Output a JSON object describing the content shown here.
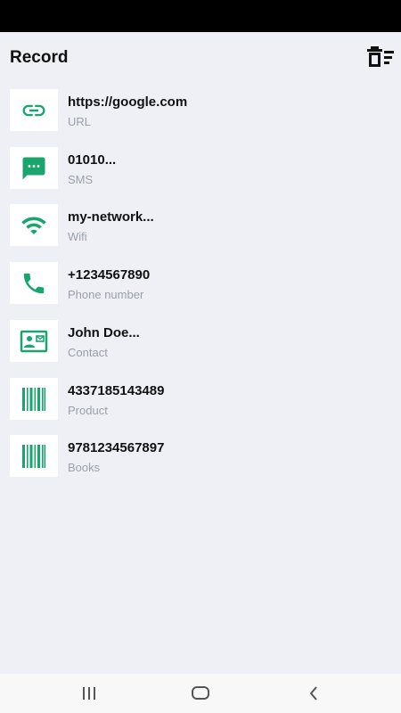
{
  "app_bar": {
    "title": "Record",
    "clear_icon": "delete-sweep-icon"
  },
  "colors": {
    "accent": "#1aa56f",
    "background": "#eef0f5",
    "tile": "#ffffff",
    "subtitle": "#9aa0ab"
  },
  "records": [
    {
      "title": "https://google.com",
      "type": "URL",
      "icon": "link-icon"
    },
    {
      "title": "01010...",
      "type": "SMS",
      "icon": "message-icon"
    },
    {
      "title": "my-network...",
      "type": "Wifi",
      "icon": "wifi-icon"
    },
    {
      "title": "+1234567890",
      "type": "Phone number",
      "icon": "phone-icon"
    },
    {
      "title": "John Doe...",
      "type": "Contact",
      "icon": "contact-card-icon"
    },
    {
      "title": "4337185143489",
      "type": "Product",
      "icon": "barcode-icon"
    },
    {
      "title": "9781234567897",
      "type": "Books",
      "icon": "barcode-icon"
    }
  ],
  "nav_bar": {
    "recents_icon": "recents-icon",
    "home_icon": "home-icon",
    "back_icon": "back-icon"
  }
}
